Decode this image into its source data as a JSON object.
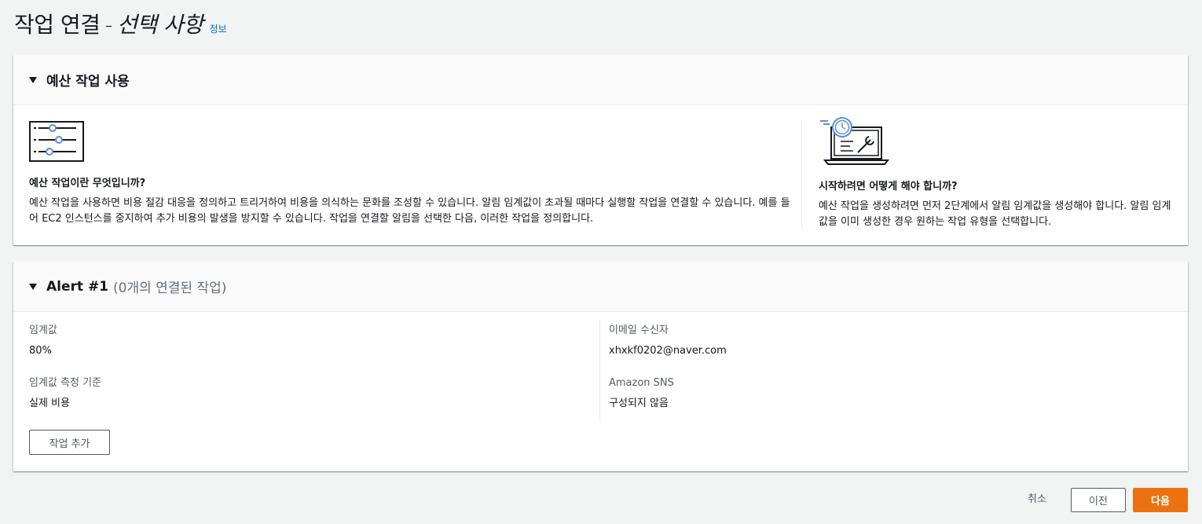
{
  "header": {
    "title_main": "작업 연결",
    "title_sep": "-",
    "title_italic": "선택 사항",
    "info_link": "정보"
  },
  "budget_panel": {
    "title": "예산 작업 사용",
    "left": {
      "heading": "예산 작업이란 무엇입니까?",
      "text": "예산 작업을 사용하면 비용 절감 대응을 정의하고 트리거하여 비용을 의식하는 문화를 조성할 수 있습니다. 알림 임계값이 초과될 때마다 실행할 작업을 연결할 수 있습니다. 예를 들어 EC2 인스턴스를 중지하여 추가 비용의 발생을 방지할 수 있습니다. 작업을 연결할 알림을 선택한 다음, 이러한 작업을 정의합니다."
    },
    "right": {
      "heading": "시작하려면 어떻게 해야 합니까?",
      "text": "예산 작업을 생성하려면 먼저 2단계에서 알림 임계값을 생성해야 합니다. 알림 임계값을 이미 생성한 경우 원하는 작업 유형을 선택합니다."
    }
  },
  "alert_panel": {
    "title": "Alert #1",
    "subtitle": "(0개의 연결된 작업)",
    "threshold_label": "임계값",
    "threshold_value": "80%",
    "basis_label": "임계값 측정 기준",
    "basis_value": "실제 비용",
    "email_label": "이메일 수신자",
    "email_value": "xhxkf0202@naver.com",
    "sns_label": "Amazon SNS",
    "sns_value": "구성되지 않음",
    "add_action_button": "작업 추가"
  },
  "footer": {
    "cancel": "취소",
    "previous": "이전",
    "next": "다음"
  },
  "colors": {
    "primary_button": "#ec7211",
    "link": "#0073bb",
    "icon_accent": "#5b8fd6"
  }
}
